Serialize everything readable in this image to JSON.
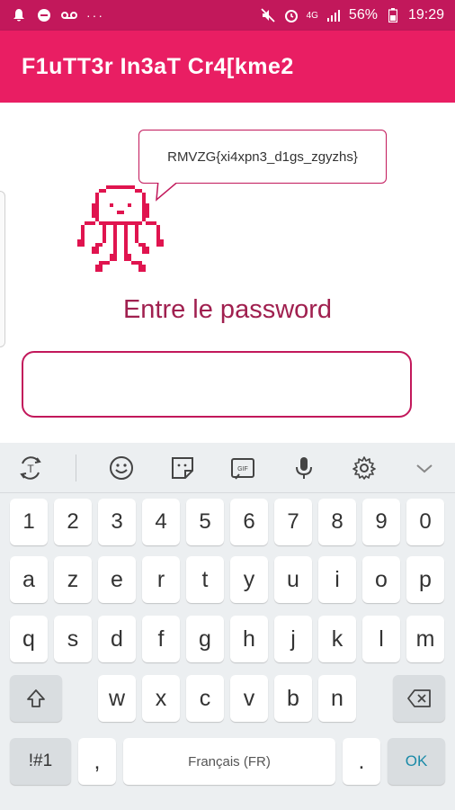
{
  "status_bar": {
    "network": "4G",
    "battery": "56%",
    "time": "19:29",
    "dots": "···"
  },
  "app_bar": {
    "title": "F1uTT3r In3aT Cr4[kme2"
  },
  "speech_bubble": {
    "text": "RMVZG{xi4xpn3_d1gs_zgyzhs}"
  },
  "prompt": {
    "label": "Entre le password"
  },
  "password_field": {
    "value": ""
  },
  "keyboard": {
    "toolbar": [
      "text-switch-icon",
      "emoji-icon",
      "sticker-icon",
      "gif-icon",
      "mic-icon",
      "settings-icon",
      "chevron-down-icon"
    ],
    "number_row": [
      "1",
      "2",
      "3",
      "4",
      "5",
      "6",
      "7",
      "8",
      "9",
      "0"
    ],
    "row1": [
      "a",
      "z",
      "e",
      "r",
      "t",
      "y",
      "u",
      "i",
      "o",
      "p"
    ],
    "row2": [
      "q",
      "s",
      "d",
      "f",
      "g",
      "h",
      "j",
      "k",
      "l",
      "m"
    ],
    "row3": [
      "w",
      "x",
      "c",
      "v",
      "b",
      "n"
    ],
    "symbols_label": "!#1",
    "comma_label": ",",
    "space_label": "Français (FR)",
    "period_label": ".",
    "ok_label": "OK"
  },
  "colors": {
    "accent": "#e91e63",
    "accent_dark": "#c2185b",
    "prompt_text": "#a0204f"
  }
}
